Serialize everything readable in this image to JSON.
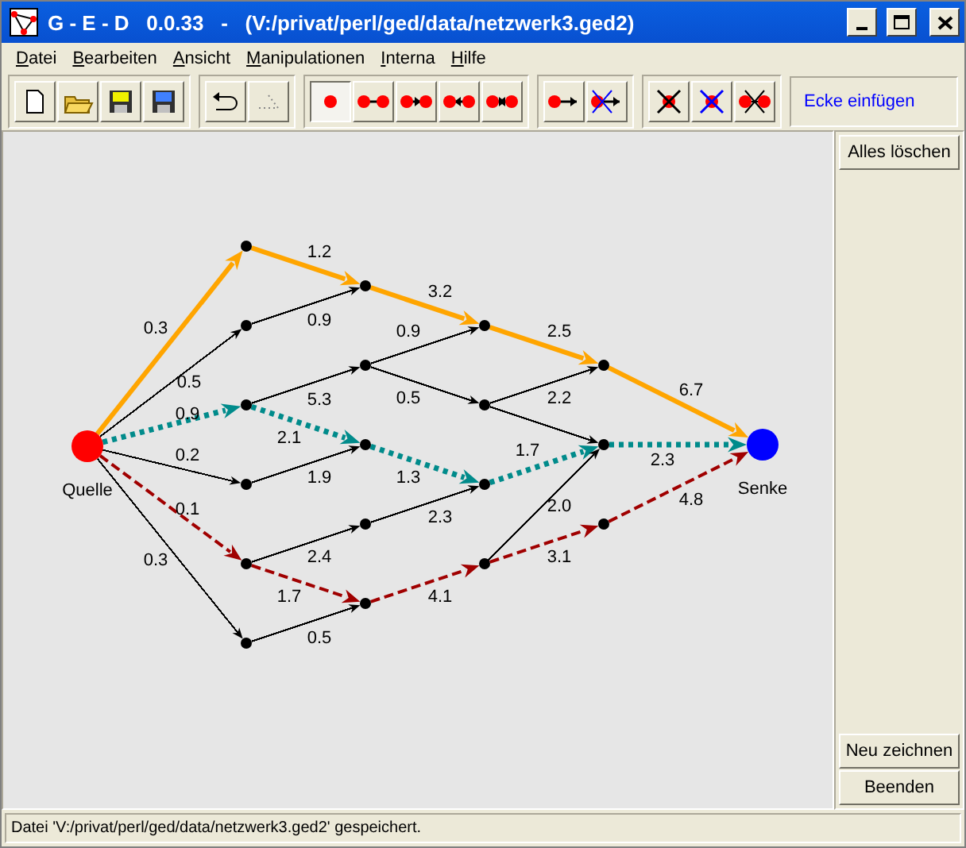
{
  "window": {
    "title": "G - E - D   0.0.33   -   (V:/privat/perl/ged/data/netzwerk3.ged2)"
  },
  "menu": [
    "Datei",
    "Bearbeiten",
    "Ansicht",
    "Manipulationen",
    "Interna",
    "Hilfe"
  ],
  "toolbar": [
    {
      "tools": [
        {
          "kind": "new",
          "selected": false
        },
        {
          "kind": "open",
          "selected": false
        },
        {
          "kind": "save",
          "selected": false
        },
        {
          "kind": "save-as",
          "selected": false
        }
      ]
    },
    {
      "tools": [
        {
          "kind": "undo",
          "selected": false
        },
        {
          "kind": "redo",
          "selected": false
        }
      ]
    },
    {
      "tools": [
        {
          "kind": "vertex",
          "selected": true
        },
        {
          "kind": "edge",
          "selected": false
        },
        {
          "kind": "arc-right",
          "selected": false
        },
        {
          "kind": "arc-left",
          "selected": false
        },
        {
          "kind": "arc-both",
          "selected": false
        }
      ]
    },
    {
      "tools": [
        {
          "kind": "arrow",
          "selected": false
        },
        {
          "kind": "arrow-cross",
          "selected": false
        }
      ]
    },
    {
      "tools": [
        {
          "kind": "delete-vertex",
          "selected": false
        },
        {
          "kind": "delete-vertex-blue",
          "selected": false
        },
        {
          "kind": "delete-edge",
          "selected": false
        }
      ]
    }
  ],
  "mode_label": "Ecke einfügen",
  "graph": {
    "nodes": [
      {
        "kind": "source",
        "label": "Quelle",
        "color": "#ff0000"
      },
      {
        "kind": "point"
      },
      {
        "kind": "point"
      },
      {
        "kind": "point"
      },
      {
        "kind": "point"
      },
      {
        "kind": "point"
      },
      {
        "kind": "point"
      },
      {
        "kind": "point"
      },
      {
        "kind": "point"
      },
      {
        "kind": "point"
      },
      {
        "kind": "point"
      },
      {
        "kind": "point"
      },
      {
        "kind": "point"
      },
      {
        "kind": "point"
      },
      {
        "kind": "point"
      },
      {
        "kind": "point"
      },
      {
        "kind": "point"
      },
      {
        "kind": "point"
      },
      {
        "kind": "point"
      },
      {
        "kind": "sink",
        "label": "Senke",
        "color": "#0000ff"
      }
    ],
    "edges": [
      {
        "label": "0.3",
        "kind": "solid",
        "color": "#ffa500"
      },
      {
        "label": "0.5",
        "kind": "plain",
        "color": "#000000"
      },
      {
        "label": "0.9",
        "kind": "dotted",
        "color": "#008b8b"
      },
      {
        "label": "0.2",
        "kind": "plain",
        "color": "#000000"
      },
      {
        "label": "0.1",
        "kind": "dashed",
        "color": "#a00000"
      },
      {
        "label": "0.3",
        "kind": "plain",
        "color": "#000000"
      },
      {
        "label": "1.2",
        "kind": "solid",
        "color": "#ffa500"
      },
      {
        "label": "0.9",
        "kind": "plain",
        "color": "#000000"
      },
      {
        "label": "5.3",
        "kind": "plain",
        "color": "#000000"
      },
      {
        "label": "2.1",
        "kind": "dotted",
        "color": "#008b8b"
      },
      {
        "label": "1.9",
        "kind": "plain",
        "color": "#000000"
      },
      {
        "label": "2.4",
        "kind": "plain",
        "color": "#000000"
      },
      {
        "label": "1.7",
        "kind": "dashed",
        "color": "#a00000"
      },
      {
        "label": "0.5",
        "kind": "plain",
        "color": "#000000"
      },
      {
        "label": "3.2",
        "kind": "solid",
        "color": "#ffa500"
      },
      {
        "label": "0.9",
        "kind": "plain",
        "color": "#000000"
      },
      {
        "label": "0.5",
        "kind": "plain",
        "color": "#000000"
      },
      {
        "label": "1.3",
        "kind": "dotted",
        "color": "#008b8b"
      },
      {
        "label": "2.3",
        "kind": "plain",
        "color": "#000000"
      },
      {
        "label": "4.1",
        "kind": "dashed",
        "color": "#a00000"
      },
      {
        "label": "2.5",
        "kind": "solid",
        "color": "#ffa500"
      },
      {
        "label": "2.2",
        "kind": "plain",
        "color": "#000000"
      },
      {
        "kind": "plain",
        "color": "#000000"
      },
      {
        "label": "1.7",
        "kind": "dotted",
        "color": "#008b8b"
      },
      {
        "label": "2.0",
        "kind": "plain",
        "color": "#000000"
      },
      {
        "label": "3.1",
        "kind": "dashed",
        "color": "#a00000"
      },
      {
        "label": "6.7",
        "kind": "solid",
        "color": "#ffa500"
      },
      {
        "label": "2.3",
        "kind": "dotted",
        "color": "#008b8b"
      },
      {
        "label": "4.8",
        "kind": "dashed",
        "color": "#a00000"
      }
    ]
  },
  "side_buttons_top": [
    "Alles löschen"
  ],
  "side_buttons_bottom": [
    "Neu zeichnen",
    "Beenden"
  ],
  "status_bar": "Datei 'V:/privat/perl/ged/data/netzwerk3.ged2' gespeichert."
}
